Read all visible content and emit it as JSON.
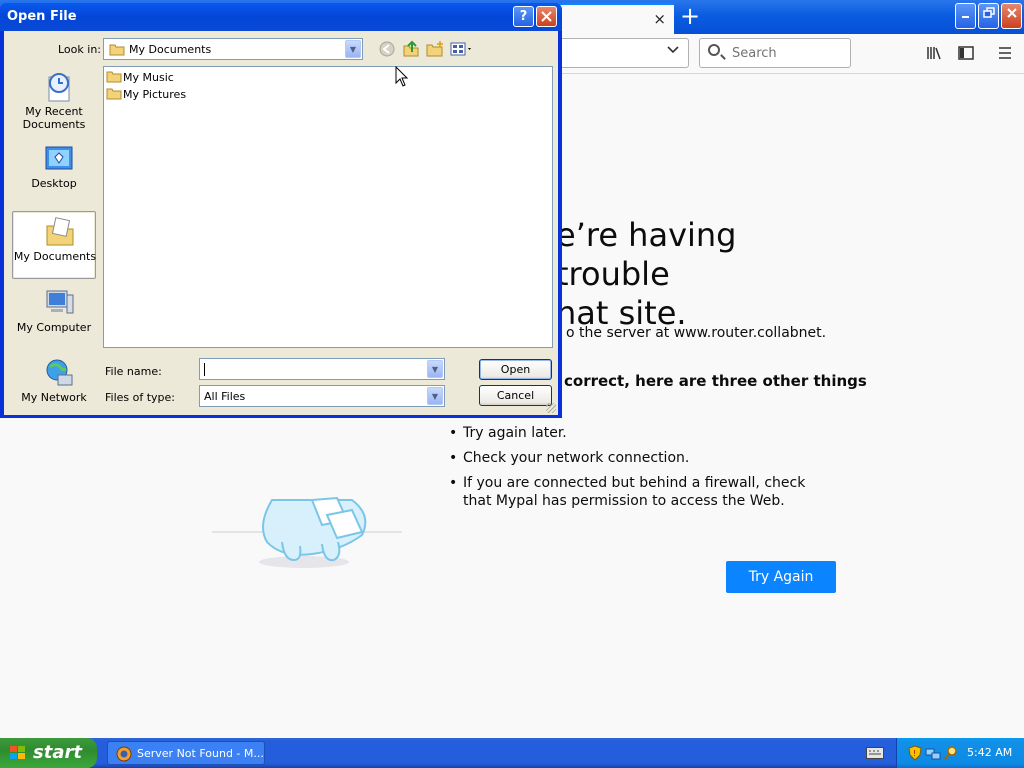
{
  "browser": {
    "tab_close_glyph": "×",
    "new_tab_glyph": "+",
    "search_placeholder": "Search",
    "window_buttons": {
      "minimize": "_",
      "restore": "❐",
      "close": "✕"
    }
  },
  "error_page": {
    "title": "e’re having trouble\nhat site.",
    "description": "o the server at www.router.collabnet.",
    "subheading": "correct, here are three other things",
    "suggestions": [
      "Try again later.",
      "Check your network connection.",
      "If you are connected but behind a firewall, check that Mypal has permission to access the Web."
    ],
    "try_again_label": "Try Again"
  },
  "dialog": {
    "title": "Open File",
    "help_glyph": "?",
    "close_glyph": "✕",
    "look_in_label": "Look in:",
    "look_in_value": "My Documents",
    "places": [
      {
        "label": "My Recent Documents",
        "icon": "recent-documents-icon"
      },
      {
        "label": "Desktop",
        "icon": "desktop-icon"
      },
      {
        "label": "My Documents",
        "icon": "my-documents-icon",
        "active": true
      },
      {
        "label": "My Computer",
        "icon": "my-computer-icon"
      },
      {
        "label": "My Network",
        "icon": "my-network-icon"
      }
    ],
    "files": [
      "My Music",
      "My Pictures"
    ],
    "file_name_label": "File name:",
    "file_name_value": "",
    "files_of_type_label": "Files of type:",
    "files_of_type_value": "All Files",
    "open_label": "Open",
    "cancel_label": "Cancel"
  },
  "taskbar": {
    "start_label": "start",
    "task_label": "Server Not Found - M...",
    "clock": "5:42 AM"
  },
  "colors": {
    "xp_blue": "#0a58ee",
    "firefox_blue": "#0a84ff",
    "start_green": "#3c9a3c"
  }
}
